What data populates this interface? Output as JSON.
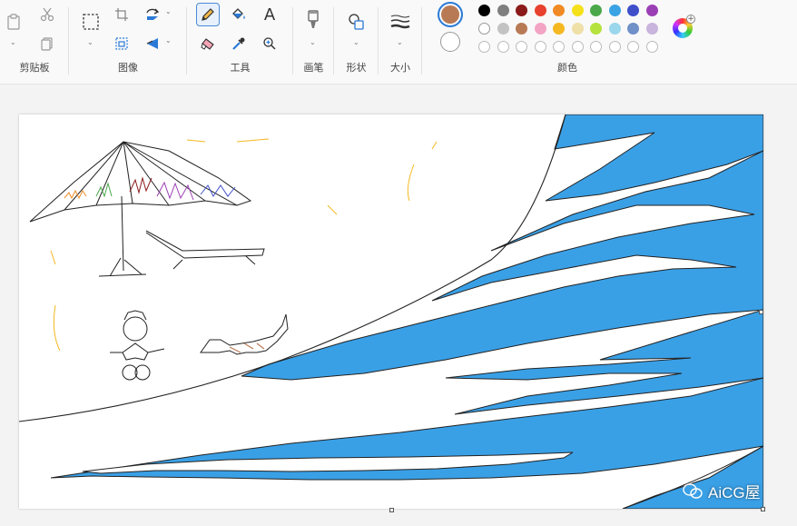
{
  "groups": {
    "clipboard": "剪贴板",
    "image": "图像",
    "tools": "工具",
    "brushes": "画笔",
    "shapes": "形状",
    "size": "大小",
    "colors": "颜色"
  },
  "tool_label": "A",
  "colors": {
    "primary": "#b87a55",
    "secondary": "#ffffff",
    "row1": [
      "#000000",
      "#7f7f7f",
      "#8b1a1a",
      "#e8412f",
      "#f08a24",
      "#f5e11b",
      "#4aa84a",
      "#3aa3e3",
      "#3e4fc9",
      "#9b3fb5"
    ],
    "row2": [
      "#ffffff",
      "#c3c3c3",
      "#b87a55",
      "#f3a4c4",
      "#f5b820",
      "#efe0a8",
      "#b5e23c",
      "#9ad7ec",
      "#7090c8",
      "#c8b4dc"
    ],
    "row3_count": 10
  },
  "watermark": "AiCG屋",
  "canvas": {
    "sea_color": "#3aa0e6"
  }
}
